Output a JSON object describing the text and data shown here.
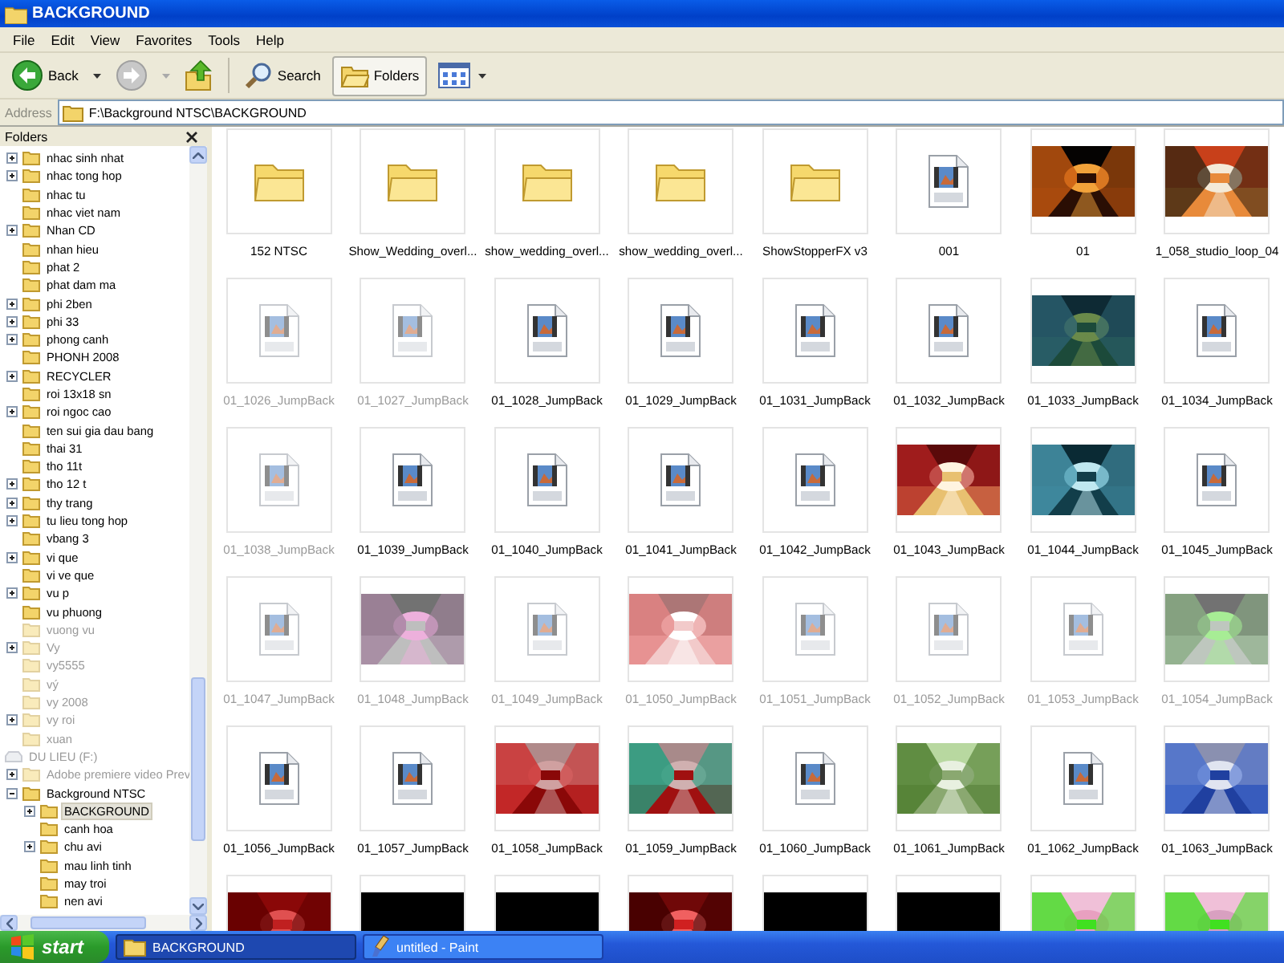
{
  "window": {
    "title": "BACKGROUND"
  },
  "menu": [
    "File",
    "Edit",
    "View",
    "Favorites",
    "Tools",
    "Help"
  ],
  "toolbar": {
    "back": {
      "label": "Back",
      "disabled": false
    },
    "forward": {
      "disabled": true
    },
    "search": {
      "label": "Search"
    },
    "folders": {
      "label": "Folders",
      "selected": true
    }
  },
  "address": {
    "label": "Address",
    "value": "F:\\Background NTSC\\BACKGROUND"
  },
  "folders_pane": {
    "title": "Folders",
    "tree": [
      {
        "label": "nhac sinh nhat",
        "kind": "folder",
        "has_children": true,
        "expanded": false,
        "dimmed": false,
        "selected": false
      },
      {
        "label": "nhac tong hop",
        "kind": "folder",
        "has_children": true,
        "expanded": false,
        "dimmed": false,
        "selected": false
      },
      {
        "label": "nhac tu",
        "kind": "folder",
        "has_children": false,
        "dimmed": false,
        "selected": false
      },
      {
        "label": "nhac viet nam",
        "kind": "folder",
        "has_children": false,
        "dimmed": false,
        "selected": false
      },
      {
        "label": "Nhan CD",
        "kind": "folder",
        "has_children": true,
        "expanded": false,
        "dimmed": false,
        "selected": false
      },
      {
        "label": "nhan hieu",
        "kind": "folder",
        "has_children": false,
        "dimmed": false,
        "selected": false
      },
      {
        "label": "phat 2",
        "kind": "folder",
        "has_children": false,
        "dimmed": false,
        "selected": false
      },
      {
        "label": "phat dam ma",
        "kind": "folder",
        "has_children": false,
        "dimmed": false,
        "selected": false
      },
      {
        "label": "phi 2ben",
        "kind": "folder",
        "has_children": true,
        "expanded": false,
        "dimmed": false,
        "selected": false
      },
      {
        "label": "phi 33",
        "kind": "folder",
        "has_children": true,
        "expanded": false,
        "dimmed": false,
        "selected": false
      },
      {
        "label": "phong canh",
        "kind": "folder",
        "has_children": true,
        "expanded": false,
        "dimmed": false,
        "selected": false
      },
      {
        "label": "PHONH 2008",
        "kind": "folder",
        "has_children": false,
        "dimmed": false,
        "selected": false
      },
      {
        "label": "RECYCLER",
        "kind": "folder",
        "has_children": true,
        "expanded": false,
        "dimmed": false,
        "selected": false
      },
      {
        "label": "roi 13x18 sn",
        "kind": "folder",
        "has_children": false,
        "dimmed": false,
        "selected": false
      },
      {
        "label": "roi ngoc cao",
        "kind": "folder",
        "has_children": true,
        "expanded": false,
        "dimmed": false,
        "selected": false
      },
      {
        "label": "ten sui gia dau bang",
        "kind": "folder",
        "has_children": false,
        "dimmed": false,
        "selected": false
      },
      {
        "label": "thai 31",
        "kind": "folder",
        "has_children": false,
        "dimmed": false,
        "selected": false
      },
      {
        "label": "tho 11t",
        "kind": "folder",
        "has_children": false,
        "dimmed": false,
        "selected": false
      },
      {
        "label": "tho 12 t",
        "kind": "folder",
        "has_children": true,
        "expanded": false,
        "dimmed": false,
        "selected": false
      },
      {
        "label": "thy trang",
        "kind": "folder",
        "has_children": true,
        "expanded": false,
        "dimmed": false,
        "selected": false
      },
      {
        "label": "tu lieu tong hop",
        "kind": "folder",
        "has_children": true,
        "expanded": false,
        "dimmed": false,
        "selected": false
      },
      {
        "label": "vbang 3",
        "kind": "folder",
        "has_children": false,
        "dimmed": false,
        "selected": false
      },
      {
        "label": "vi que",
        "kind": "folder",
        "has_children": true,
        "expanded": false,
        "dimmed": false,
        "selected": false
      },
      {
        "label": "vi ve que",
        "kind": "folder",
        "has_children": false,
        "dimmed": false,
        "selected": false
      },
      {
        "label": "vu p",
        "kind": "folder",
        "has_children": true,
        "expanded": false,
        "dimmed": false,
        "selected": false
      },
      {
        "label": "vu phuong",
        "kind": "folder",
        "has_children": false,
        "dimmed": false,
        "selected": false
      },
      {
        "label": "vuong vu",
        "kind": "folder",
        "has_children": false,
        "dimmed": true,
        "selected": false
      },
      {
        "label": "Vy",
        "kind": "folder",
        "has_children": true,
        "expanded": false,
        "dimmed": true,
        "selected": false
      },
      {
        "label": "vy5555",
        "kind": "folder",
        "has_children": false,
        "dimmed": true,
        "selected": false
      },
      {
        "label": "vý",
        "kind": "folder",
        "has_children": false,
        "dimmed": true,
        "selected": false
      },
      {
        "label": "vy 2008",
        "kind": "folder",
        "has_children": false,
        "dimmed": true,
        "selected": false
      },
      {
        "label": "vy roi",
        "kind": "folder",
        "has_children": true,
        "expanded": false,
        "dimmed": true,
        "selected": false
      },
      {
        "label": "xuan",
        "kind": "folder",
        "has_children": false,
        "dimmed": true,
        "selected": false
      },
      {
        "label": "DU LIEU (F:)",
        "kind": "drive",
        "dimmed": true,
        "selected": false,
        "children": [
          {
            "label": "Adobe premiere video Prev",
            "kind": "folder",
            "has_children": true,
            "expanded": false,
            "dimmed": true,
            "selected": false
          },
          {
            "label": "Background NTSC",
            "kind": "folder",
            "has_children": true,
            "expanded": true,
            "dimmed": false,
            "selected": false,
            "children": [
              {
                "label": "BACKGROUND",
                "kind": "folder",
                "has_children": true,
                "expanded": false,
                "dimmed": false,
                "selected": true
              },
              {
                "label": "canh hoa",
                "kind": "folder",
                "has_children": false,
                "dimmed": false,
                "selected": false
              },
              {
                "label": "chu avi",
                "kind": "folder",
                "has_children": true,
                "expanded": false,
                "dimmed": false,
                "selected": false
              },
              {
                "label": "mau linh tinh",
                "kind": "folder",
                "has_children": false,
                "dimmed": false,
                "selected": false
              },
              {
                "label": "may troi",
                "kind": "folder",
                "has_children": false,
                "dimmed": false,
                "selected": false
              },
              {
                "label": "nen avi",
                "kind": "folder",
                "has_children": false,
                "dimmed": false,
                "selected": false
              }
            ]
          }
        ]
      }
    ]
  },
  "files": [
    {
      "name": "152 NTSC",
      "kind": "folder",
      "dimmed": false
    },
    {
      "name": "Show_Wedding_overl...",
      "kind": "folder",
      "dimmed": false
    },
    {
      "name": "show_wedding_overl...",
      "kind": "folder",
      "dimmed": false
    },
    {
      "name": "show_wedding_overl...",
      "kind": "folder",
      "dimmed": false
    },
    {
      "name": "ShowStopperFX v3",
      "kind": "folder",
      "dimmed": false
    },
    {
      "name": "001",
      "kind": "video",
      "dimmed": false
    },
    {
      "name": "01",
      "kind": "picture",
      "dimmed": false
    },
    {
      "name": "1_058_studio_loop_04",
      "kind": "picture",
      "dimmed": false
    },
    {
      "name": "01_1026_JumpBack",
      "kind": "video",
      "dimmed": true
    },
    {
      "name": "01_1027_JumpBack",
      "kind": "video",
      "dimmed": true
    },
    {
      "name": "01_1028_JumpBack",
      "kind": "video",
      "dimmed": false
    },
    {
      "name": "01_1029_JumpBack",
      "kind": "video",
      "dimmed": false
    },
    {
      "name": "01_1031_JumpBack",
      "kind": "video",
      "dimmed": false
    },
    {
      "name": "01_1032_JumpBack",
      "kind": "video",
      "dimmed": false
    },
    {
      "name": "01_1033_JumpBack",
      "kind": "picture",
      "dimmed": false
    },
    {
      "name": "01_1034_JumpBack",
      "kind": "video",
      "dimmed": false
    },
    {
      "name": "01_1038_JumpBack",
      "kind": "video",
      "dimmed": true
    },
    {
      "name": "01_1039_JumpBack",
      "kind": "video",
      "dimmed": false
    },
    {
      "name": "01_1040_JumpBack",
      "kind": "video",
      "dimmed": false
    },
    {
      "name": "01_1041_JumpBack",
      "kind": "video",
      "dimmed": false
    },
    {
      "name": "01_1042_JumpBack",
      "kind": "video",
      "dimmed": false
    },
    {
      "name": "01_1043_JumpBack",
      "kind": "picture",
      "dimmed": false
    },
    {
      "name": "01_1044_JumpBack",
      "kind": "picture",
      "dimmed": false
    },
    {
      "name": "01_1045_JumpBack",
      "kind": "video",
      "dimmed": false
    },
    {
      "name": "01_1047_JumpBack",
      "kind": "video",
      "dimmed": true
    },
    {
      "name": "01_1048_JumpBack",
      "kind": "picture",
      "dimmed": true
    },
    {
      "name": "01_1049_JumpBack",
      "kind": "video",
      "dimmed": true
    },
    {
      "name": "01_1050_JumpBack",
      "kind": "picture",
      "dimmed": true
    },
    {
      "name": "01_1051_JumpBack",
      "kind": "video",
      "dimmed": true
    },
    {
      "name": "01_1052_JumpBack",
      "kind": "video",
      "dimmed": true
    },
    {
      "name": "01_1053_JumpBack",
      "kind": "video",
      "dimmed": true
    },
    {
      "name": "01_1054_JumpBack",
      "kind": "picture",
      "dimmed": true
    },
    {
      "name": "01_1056_JumpBack",
      "kind": "video",
      "dimmed": false
    },
    {
      "name": "01_1057_JumpBack",
      "kind": "video",
      "dimmed": false
    },
    {
      "name": "01_1058_JumpBack",
      "kind": "picture",
      "dimmed": false
    },
    {
      "name": "01_1059_JumpBack",
      "kind": "picture",
      "dimmed": false
    },
    {
      "name": "01_1060_JumpBack",
      "kind": "video",
      "dimmed": false
    },
    {
      "name": "01_1061_JumpBack",
      "kind": "picture",
      "dimmed": false
    },
    {
      "name": "01_1062_JumpBack",
      "kind": "video",
      "dimmed": false
    },
    {
      "name": "01_1063_JumpBack",
      "kind": "picture",
      "dimmed": false
    },
    {
      "kind": "picture",
      "dimmed": false
    },
    {
      "kind": "picture",
      "dimmed": false
    },
    {
      "kind": "picture",
      "dimmed": false
    },
    {
      "kind": "picture",
      "dimmed": false
    },
    {
      "kind": "picture",
      "dimmed": false
    },
    {
      "kind": "picture",
      "dimmed": false
    },
    {
      "kind": "picture",
      "dimmed": false
    },
    {
      "kind": "picture",
      "dimmed": false
    }
  ],
  "taskbar": {
    "start": "start",
    "tasks": [
      {
        "label": "BACKGROUND",
        "kind": "explorer",
        "selected": true
      },
      {
        "label": "untitled - Paint",
        "kind": "paint",
        "selected": false
      }
    ]
  }
}
